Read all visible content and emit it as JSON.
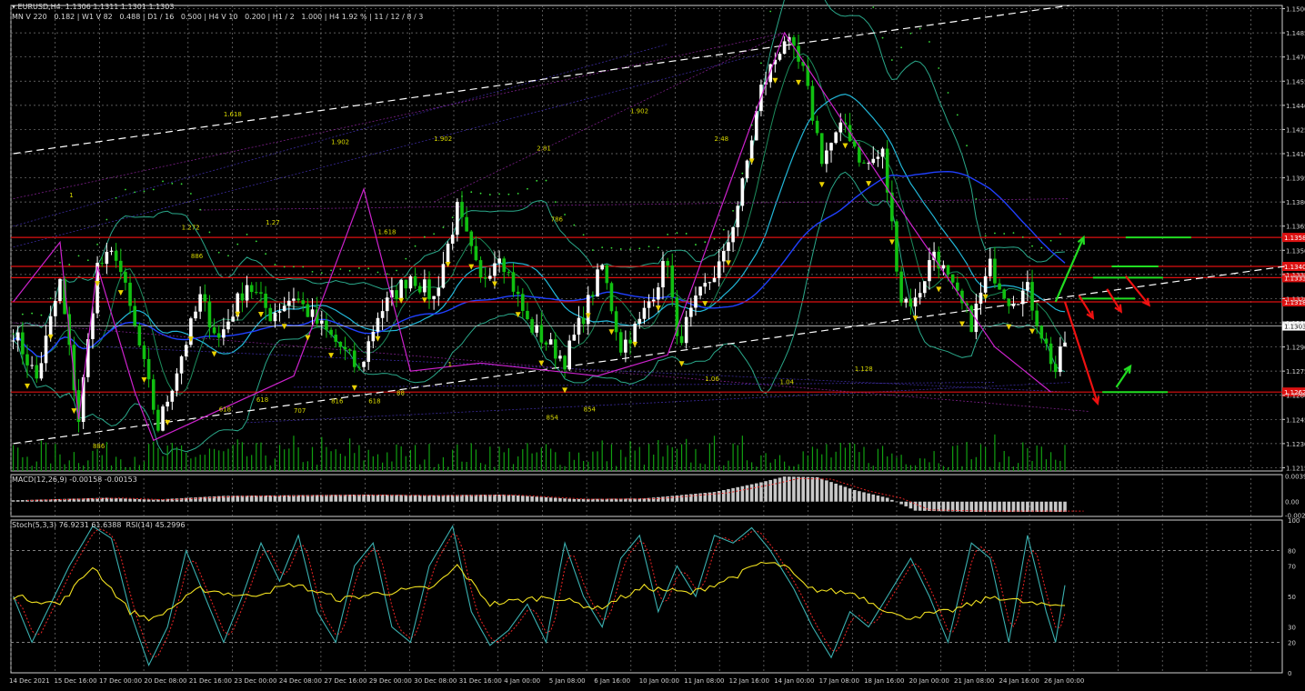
{
  "header": {
    "line1": "▾ EURUSD,H4  1.1306 1.1311 1.1301 1.1303",
    "line2": "MN V 220   0.182 | W1 V 82   0.488 | D1 / 16   0.500 | H4 V 10   0.200 | H1 / 2   1.000 | H4 1.92 % | 11 / 12 / 8 / 3"
  },
  "colors": {
    "background": "#000000",
    "grid": "#7a7a7a",
    "frame": "#d0d0d0",
    "bull_candle": "#ffffff",
    "bear_candle": "#11c011",
    "volume": "#11a011",
    "resistance": "#dd1111",
    "trendline": "#ffffff",
    "zigzag": "#cc22cc",
    "fibo_label": "#d8d800",
    "fractal": "#e8d000",
    "bollinger": "#2aa88a",
    "ma_blue": "#2040ff",
    "ma_cyan": "#22b7d8",
    "arrow_up": "#22dd22",
    "arrow_down": "#ee1111",
    "macd_hist": "#c8c8c8",
    "macd_signal": "#dd2222",
    "stoch_main": "#3ab0b0",
    "stoch_signal": "#dd2222",
    "rsi": "#f0e020"
  },
  "chart_data": [
    {
      "type": "candlestick",
      "title": "EURUSD,H4",
      "ylim": [
        1.1213,
        1.1502
      ],
      "y_ticks": [
        "1.1500",
        "1.1485",
        "1.1470",
        "1.1455",
        "1.1440",
        "1.1425",
        "1.1410",
        "1.1395",
        "1.1380",
        "1.1365",
        "1.1350",
        "1.1335",
        "1.1320",
        "1.1305",
        "1.1290",
        "1.1275",
        "1.1260",
        "1.1245",
        "1.1230",
        "1.1215"
      ],
      "x_ticks": [
        "14 Dec 2021",
        "15 Dec 16:00",
        "17 Dec 00:00",
        "20 Dec 08:00",
        "21 Dec 16:00",
        "23 Dec 00:00",
        "24 Dec 08:00",
        "27 Dec 16:00",
        "29 Dec 00:00",
        "30 Dec 08:00",
        "31 Dec 16:00",
        "4 Jan 00:00",
        "5 Jan 08:00",
        "6 Jan 16:00",
        "10 Jan 00:00",
        "11 Jan 08:00",
        "12 Jan 16:00",
        "14 Jan 00:00",
        "17 Jan 08:00",
        "18 Jan 16:00",
        "20 Jan 00:00",
        "21 Jan 08:00",
        "24 Jan 16:00",
        "26 Jan 00:00"
      ],
      "current_price": "1.1303",
      "close_path": [
        [
          0,
          1.13
        ],
        [
          5,
          1.127
        ],
        [
          10,
          1.133
        ],
        [
          14,
          1.1245
        ],
        [
          18,
          1.134
        ],
        [
          22,
          1.1348
        ],
        [
          27,
          1.129
        ],
        [
          31,
          1.124
        ],
        [
          36,
          1.1285
        ],
        [
          40,
          1.132
        ],
        [
          44,
          1.1295
        ],
        [
          50,
          1.133
        ],
        [
          55,
          1.131
        ],
        [
          60,
          1.1322
        ],
        [
          65,
          1.1305
        ],
        [
          70,
          1.129
        ],
        [
          74,
          1.1275
        ],
        [
          78,
          1.131
        ],
        [
          85,
          1.1335
        ],
        [
          90,
          1.132
        ],
        [
          95,
          1.1375
        ],
        [
          100,
          1.133
        ],
        [
          104,
          1.135
        ],
        [
          110,
          1.1305
        ],
        [
          115,
          1.129
        ],
        [
          118,
          1.1282
        ],
        [
          122,
          1.131
        ],
        [
          126,
          1.134
        ],
        [
          130,
          1.129
        ],
        [
          134,
          1.1305
        ],
        [
          140,
          1.1345
        ],
        [
          142,
          1.1292
        ],
        [
          147,
          1.1322
        ],
        [
          152,
          1.1345
        ],
        [
          156,
          1.139
        ],
        [
          160,
          1.145
        ],
        [
          165,
          1.1482
        ],
        [
          169,
          1.146
        ],
        [
          173,
          1.1408
        ],
        [
          178,
          1.1428
        ],
        [
          182,
          1.1402
        ],
        [
          186,
          1.141
        ],
        [
          190,
          1.132
        ],
        [
          193,
          1.1318
        ],
        [
          197,
          1.135
        ],
        [
          201,
          1.1325
        ],
        [
          205,
          1.1305
        ],
        [
          209,
          1.134
        ],
        [
          213,
          1.132
        ],
        [
          217,
          1.1325
        ],
        [
          221,
          1.129
        ],
        [
          223,
          1.1275
        ],
        [
          226,
          1.1303
        ]
      ],
      "candle_count": 226,
      "resistance_levels": [
        {
          "price": 1.1358,
          "label": "1.1358"
        },
        {
          "price": 1.134,
          "label": "1.1340"
        },
        {
          "price": 1.1333,
          "label": "1.1333"
        },
        {
          "price": 1.1318,
          "label": "1.1318"
        },
        {
          "price": 1.1262,
          "label": "1.1262"
        }
      ],
      "trendlines": [
        {
          "from": [
            0,
            1.141
          ],
          "to": [
            226,
            1.1502
          ]
        },
        {
          "from": [
            0,
            1.123
          ],
          "to": [
            272,
            1.134
          ]
        }
      ],
      "zigzag": [
        [
          0,
          1.1318
        ],
        [
          10,
          1.1355
        ],
        [
          14,
          1.1245
        ],
        [
          18,
          1.134
        ],
        [
          26,
          1.1262
        ],
        [
          30,
          1.1232
        ],
        [
          60,
          1.1272
        ],
        [
          75,
          1.1388
        ],
        [
          85,
          1.1275
        ],
        [
          100,
          1.128
        ],
        [
          125,
          1.1272
        ],
        [
          140,
          1.1285
        ],
        [
          165,
          1.1485
        ],
        [
          190,
          1.1375
        ],
        [
          210,
          1.129
        ],
        [
          222,
          1.1262
        ]
      ],
      "fibo_labels": [
        {
          "i": 45,
          "p": 1.1433,
          "t": "1.618"
        },
        {
          "i": 68,
          "p": 1.1416,
          "t": "1.902"
        },
        {
          "i": 90,
          "p": 1.1418,
          "t": "1.902"
        },
        {
          "i": 132,
          "p": 1.1435,
          "t": "1.902"
        },
        {
          "i": 112,
          "p": 1.1412,
          "t": "2.81"
        },
        {
          "i": 150,
          "p": 1.1418,
          "t": "2.48"
        },
        {
          "i": 12,
          "p": 1.1383,
          "t": "1"
        },
        {
          "i": 36,
          "p": 1.1363,
          "t": "1.272"
        },
        {
          "i": 54,
          "p": 1.1366,
          "t": "1.27"
        },
        {
          "i": 78,
          "p": 1.136,
          "t": "1.618"
        },
        {
          "i": 115,
          "p": 1.1368,
          "t": "786"
        },
        {
          "i": 38,
          "p": 1.1345,
          "t": "886"
        },
        {
          "i": 93,
          "p": 1.1278,
          "t": "1"
        },
        {
          "i": 180,
          "p": 1.1275,
          "t": "1.128"
        },
        {
          "i": 148,
          "p": 1.1269,
          "t": "1.06"
        },
        {
          "i": 164,
          "p": 1.1267,
          "t": "1.04"
        },
        {
          "i": 52,
          "p": 1.1256,
          "t": "618"
        },
        {
          "i": 68,
          "p": 1.1255,
          "t": "816"
        },
        {
          "i": 76,
          "p": 1.1255,
          "t": "618"
        },
        {
          "i": 82,
          "p": 1.126,
          "t": "88"
        },
        {
          "i": 44,
          "p": 1.125,
          "t": "618"
        },
        {
          "i": 60,
          "p": 1.1249,
          "t": "707"
        },
        {
          "i": 122,
          "p": 1.125,
          "t": "854"
        },
        {
          "i": 114,
          "p": 1.1245,
          "t": "854"
        },
        {
          "i": 17,
          "p": 1.1227,
          "t": "886"
        }
      ],
      "signal_arrows": [
        {
          "dir": "up",
          "from": [
            223,
            1.1318
          ],
          "to": [
            229,
            1.1358
          ]
        },
        {
          "dir": "down",
          "from": [
            225,
            1.1318
          ],
          "to": [
            232,
            1.1255
          ]
        },
        {
          "dir": "down",
          "from": [
            228,
            1.1322
          ],
          "to": [
            231,
            1.1308
          ]
        },
        {
          "dir": "down",
          "from": [
            234,
            1.1326
          ],
          "to": [
            237,
            1.1312
          ]
        },
        {
          "dir": "down",
          "from": [
            238,
            1.1334
          ],
          "to": [
            243,
            1.1316
          ]
        },
        {
          "dir": "up",
          "from": [
            236,
            1.1265
          ],
          "to": [
            239,
            1.1278
          ]
        }
      ],
      "target_levels": [
        {
          "from": 238,
          "to": 252,
          "price": 1.1358
        },
        {
          "from": 235,
          "to": 245,
          "price": 1.134
        },
        {
          "from": 231,
          "to": 246,
          "price": 1.1333
        },
        {
          "from": 228,
          "to": 240,
          "price": 1.132
        },
        {
          "from": 233,
          "to": 247,
          "price": 1.1262
        }
      ]
    },
    {
      "type": "bar",
      "title": "MACD(12,26,9) -0.00158 -0.00153",
      "y_ticks": [
        "0.00399",
        "0.00",
        "-0.0021"
      ],
      "ylim": [
        -0.0023,
        0.0042
      ],
      "path": [
        [
          0,
          0.0002
        ],
        [
          20,
          0.0006
        ],
        [
          30,
          0.0003
        ],
        [
          45,
          0.0009
        ],
        [
          60,
          0.001
        ],
        [
          75,
          0.0011
        ],
        [
          90,
          0.001
        ],
        [
          105,
          0.0011
        ],
        [
          120,
          0.0004
        ],
        [
          135,
          0.0005
        ],
        [
          150,
          0.0015
        ],
        [
          160,
          0.003
        ],
        [
          165,
          0.0039
        ],
        [
          172,
          0.0038
        ],
        [
          180,
          0.0018
        ],
        [
          187,
          0.0006
        ],
        [
          193,
          -0.0014
        ],
        [
          205,
          -0.0016
        ],
        [
          215,
          -0.0016
        ],
        [
          226,
          -0.0016
        ]
      ]
    },
    {
      "type": "line",
      "title": "Stoch(5,3,3) 76.9231 61.6388  RSI(14) 45.2996",
      "y_ticks": [
        "100",
        "80",
        "70",
        "50",
        "30",
        "20",
        "0"
      ],
      "ylim": [
        0,
        100
      ],
      "stoch_path": [
        [
          0,
          50
        ],
        [
          4,
          20
        ],
        [
          8,
          45
        ],
        [
          12,
          70
        ],
        [
          17,
          96
        ],
        [
          21,
          88
        ],
        [
          25,
          40
        ],
        [
          29,
          5
        ],
        [
          33,
          30
        ],
        [
          37,
          80
        ],
        [
          41,
          50
        ],
        [
          45,
          20
        ],
        [
          49,
          50
        ],
        [
          53,
          85
        ],
        [
          57,
          60
        ],
        [
          61,
          90
        ],
        [
          65,
          40
        ],
        [
          69,
          20
        ],
        [
          73,
          70
        ],
        [
          77,
          85
        ],
        [
          81,
          30
        ],
        [
          85,
          20
        ],
        [
          89,
          70
        ],
        [
          94,
          96
        ],
        [
          98,
          40
        ],
        [
          102,
          18
        ],
        [
          106,
          28
        ],
        [
          110,
          45
        ],
        [
          114,
          20
        ],
        [
          118,
          85
        ],
        [
          122,
          50
        ],
        [
          126,
          30
        ],
        [
          130,
          75
        ],
        [
          134,
          90
        ],
        [
          138,
          40
        ],
        [
          142,
          70
        ],
        [
          146,
          50
        ],
        [
          150,
          90
        ],
        [
          154,
          85
        ],
        [
          158,
          95
        ],
        [
          162,
          80
        ],
        [
          167,
          55
        ],
        [
          171,
          30
        ],
        [
          175,
          10
        ],
        [
          179,
          40
        ],
        [
          183,
          30
        ],
        [
          188,
          55
        ],
        [
          192,
          75
        ],
        [
          196,
          50
        ],
        [
          200,
          20
        ],
        [
          205,
          85
        ],
        [
          209,
          75
        ],
        [
          213,
          20
        ],
        [
          217,
          90
        ],
        [
          221,
          40
        ],
        [
          223,
          20
        ],
        [
          226,
          76
        ]
      ],
      "rsi_path": [
        [
          0,
          50
        ],
        [
          10,
          45
        ],
        [
          17,
          70
        ],
        [
          25,
          40
        ],
        [
          30,
          35
        ],
        [
          40,
          55
        ],
        [
          50,
          50
        ],
        [
          60,
          58
        ],
        [
          70,
          48
        ],
        [
          78,
          52
        ],
        [
          90,
          56
        ],
        [
          95,
          70
        ],
        [
          102,
          45
        ],
        [
          115,
          50
        ],
        [
          125,
          42
        ],
        [
          135,
          56
        ],
        [
          145,
          52
        ],
        [
          155,
          64
        ],
        [
          160,
          72
        ],
        [
          165,
          70
        ],
        [
          170,
          55
        ],
        [
          180,
          52
        ],
        [
          190,
          36
        ],
        [
          200,
          40
        ],
        [
          210,
          50
        ],
        [
          220,
          44
        ],
        [
          226,
          45
        ]
      ]
    }
  ]
}
